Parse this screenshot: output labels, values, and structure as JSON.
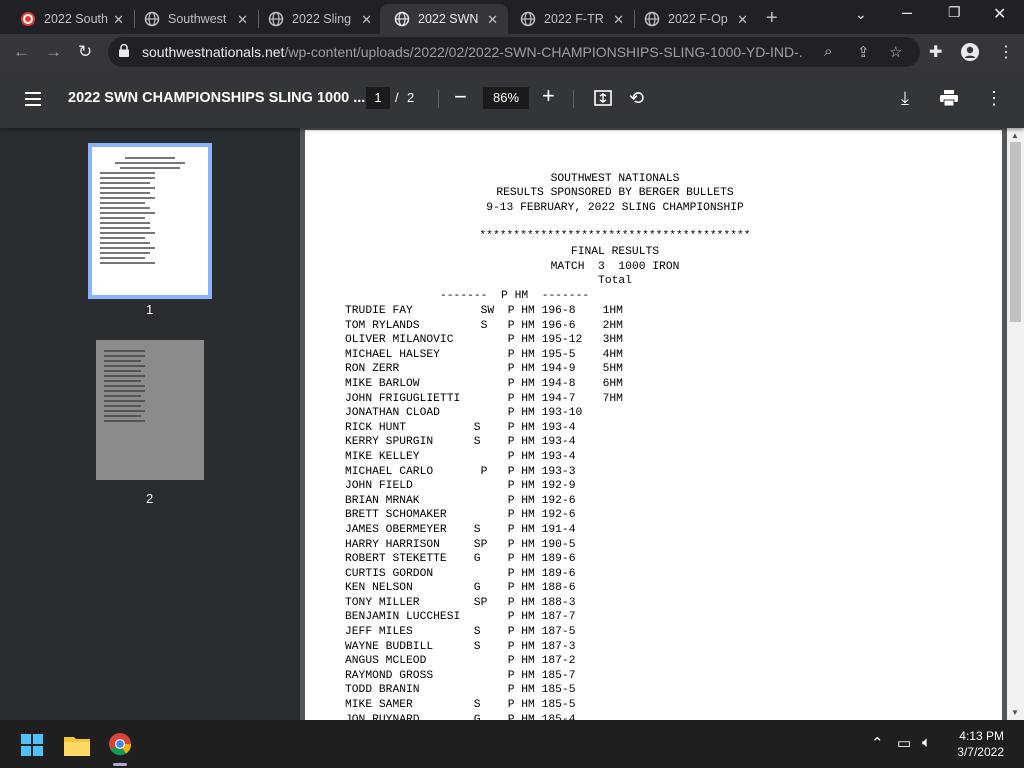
{
  "tabs": [
    {
      "title": "2022 South",
      "icon": "target-icon",
      "active": false
    },
    {
      "title": "Southwest",
      "icon": "globe-icon",
      "active": false
    },
    {
      "title": "2022 Sling",
      "icon": "globe-icon",
      "active": false
    },
    {
      "title": "2022 SWN",
      "icon": "globe-icon",
      "active": true
    },
    {
      "title": "2022 F-TR",
      "icon": "globe-icon",
      "active": false
    },
    {
      "title": "2022 F-Op",
      "icon": "globe-icon",
      "active": false
    }
  ],
  "address_bar": {
    "host": "southwestnationals.net",
    "path": "/wp-content/uploads/2022/02/2022-SWN-CHAMPIONSHIPS-SLING-1000-YD-IND-..."
  },
  "pdf_toolbar": {
    "title": "2022 SWN CHAMPIONSHIPS SLING 1000 ...",
    "current_page": "1",
    "page_separator": "/",
    "total_pages": "2",
    "zoom": "86%"
  },
  "thumbnails": [
    {
      "label": "1",
      "selected": true
    },
    {
      "label": "2",
      "selected": false
    }
  ],
  "document": {
    "header_lines": [
      "SOUTHWEST NATIONALS",
      "RESULTS SPONSORED BY BERGER BULLETS",
      "9-13 FEBRUARY, 2022 SLING CHAMPIONSHIP"
    ],
    "stars": "****************************************",
    "final_results": "FINAL RESULTS",
    "match_line": "MATCH  3  1000 IRON",
    "total_label": "Total",
    "column_header": "-------  P HM  -------",
    "rows": [
      "TRUDIE FAY          SW  P HM 196-8    1HM",
      "TOM RYLANDS         S   P HM 196-6    2HM",
      "OLIVER MILANOVIC        P HM 195-12   3HM",
      "MICHAEL HALSEY          P HM 195-5    4HM",
      "RON ZERR                P HM 194-9    5HM",
      "MIKE BARLOW             P HM 194-8    6HM",
      "JOHN FRIGUGLIETTI       P HM 194-7    7HM",
      "JONATHAN CLOAD          P HM 193-10",
      "RICK HUNT          S    P HM 193-4",
      "KERRY SPURGIN      S    P HM 193-4",
      "MIKE KELLEY             P HM 193-4",
      "MICHAEL CARLO       P   P HM 193-3",
      "JOHN FIELD              P HM 192-9",
      "BRIAN MRNAK             P HM 192-6",
      "BRETT SCHOMAKER         P HM 192-6",
      "JAMES OBERMEYER    S    P HM 191-4",
      "HARRY HARRISON     SP   P HM 190-5",
      "ROBERT STEKETTE    G    P HM 189-6",
      "CURTIS GORDON           P HM 189-6",
      "KEN NELSON         G    P HM 188-6",
      "TONY MILLER        SP   P HM 188-3",
      "BENJAMIN LUCCHESI       P HM 187-7",
      "JEFF MILES         S    P HM 187-5",
      "WAYNE BUDBILL      S    P HM 187-3",
      "ANGUS MCLEOD            P HM 187-2",
      "RAYMOND GROSS           P HM 185-7",
      "TODD BRANIN             P HM 185-5",
      "MIKE SAMER         S    P HM 185-5",
      "JON RUYNARD        G    P HM 185-4"
    ]
  },
  "taskbar": {
    "time": "4:13 PM",
    "date": "3/7/2022"
  },
  "colors": {
    "tab_active": "#35363a",
    "pdf_toolbar": "#323639",
    "viewer_bg": "#525659",
    "thumb_selected": "#8ab4f8"
  }
}
